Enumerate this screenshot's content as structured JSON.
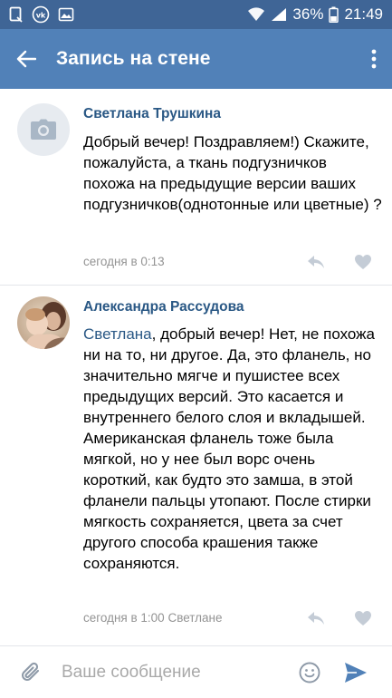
{
  "status_bar": {
    "battery": "36%",
    "time": "21:49",
    "icons": [
      "notification-icon",
      "vk-badge-icon",
      "wifi-icon",
      "signal-icon",
      "battery-icon"
    ]
  },
  "app_bar": {
    "title": "Запись на стене",
    "back_icon": "arrow-left-icon",
    "menu_icon": "more-vertical-icon"
  },
  "comments": [
    {
      "author": "Светлана Трушкина",
      "text": "Добрый вечер! Поздравляем!) Скажите, пожалуйста, а ткань подгузничков похожа на предыдущие версии ваших подгузничков(однотонные или цветные) ?",
      "meta": "сегодня в 0:13",
      "avatar": "camera-placeholder-icon"
    },
    {
      "author": "Александра Рассудова",
      "mention": "Светлана",
      "text": ", добрый вечер! Нет, не похожа ни на то, ни другое. Да, это фланель, но значительно мягче и пушистее всех предыдущих версий. Это касается и внутреннего белого слоя и вкладышей. Американская фланель тоже была мягкой, но у нее был ворс очень короткий, как будто это замша, в этой фланели пальцы утопают. После стирки мягкость сохраняется, цвета за счет другого способа крашения также сохраняются.",
      "meta": "сегодня в 1:00 Светлане",
      "avatar": "user-photo"
    }
  ],
  "composer": {
    "placeholder": "Ваше сообщение",
    "attach_icon": "paperclip-icon",
    "emoji_icon": "smiley-icon",
    "send_icon": "send-icon"
  },
  "colors": {
    "status_bar": "#3f6596",
    "app_bar": "#5181b8",
    "link": "#2a5885",
    "meta": "#939393",
    "send": "#5181b8"
  }
}
